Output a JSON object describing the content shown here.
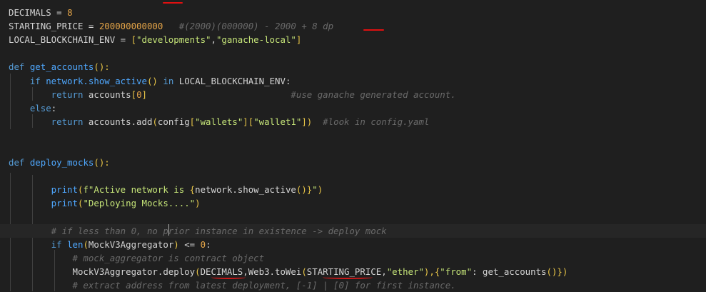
{
  "editor": {
    "lines": [
      {
        "segments": [
          {
            "t": "DECIMALS = ",
            "c": "var"
          },
          {
            "t": "8",
            "c": "num"
          }
        ]
      },
      {
        "segments": [
          {
            "t": "STARTING_PRICE = ",
            "c": "var"
          },
          {
            "t": "200000000000",
            "c": "num"
          },
          {
            "t": "   #(2000)(000000) - 2000 + 8 dp",
            "c": "cm"
          }
        ]
      },
      {
        "segments": [
          {
            "t": "LOCAL_BLOCKCHAIN_ENV = ",
            "c": "var"
          },
          {
            "t": "[",
            "c": "br"
          },
          {
            "t": "\"developments\"",
            "c": "str"
          },
          {
            "t": ",",
            "c": "op"
          },
          {
            "t": "\"ganache-local\"",
            "c": "str"
          },
          {
            "t": "]",
            "c": "br"
          }
        ]
      },
      {
        "segments": []
      },
      {
        "segments": [
          {
            "t": "def ",
            "c": "kw"
          },
          {
            "t": "get_accounts",
            "c": "fn"
          },
          {
            "t": "():",
            "c": "br"
          }
        ]
      },
      {
        "segments": [
          {
            "t": "    if ",
            "c": "kw"
          },
          {
            "t": "network.show_active",
            "c": "fn"
          },
          {
            "t": "() ",
            "c": "br"
          },
          {
            "t": "in ",
            "c": "kw"
          },
          {
            "t": "LOCAL_BLOCKCHAIN_ENV:",
            "c": "var"
          }
        ]
      },
      {
        "segments": [
          {
            "t": "        return ",
            "c": "kw"
          },
          {
            "t": "accounts",
            "c": "var"
          },
          {
            "t": "[",
            "c": "br"
          },
          {
            "t": "0",
            "c": "num"
          },
          {
            "t": "]",
            "c": "br"
          },
          {
            "t": "                           #use ganache generated account.",
            "c": "cm"
          }
        ]
      },
      {
        "segments": [
          {
            "t": "    else",
            "c": "kw"
          },
          {
            "t": ":",
            "c": "op"
          }
        ]
      },
      {
        "segments": [
          {
            "t": "        return ",
            "c": "kw"
          },
          {
            "t": "accounts.add",
            "c": "var"
          },
          {
            "t": "(",
            "c": "br"
          },
          {
            "t": "config",
            "c": "var"
          },
          {
            "t": "[",
            "c": "br"
          },
          {
            "t": "\"wallets\"",
            "c": "str"
          },
          {
            "t": "][",
            "c": "br"
          },
          {
            "t": "\"wallet1\"",
            "c": "str"
          },
          {
            "t": "])",
            "c": "br"
          },
          {
            "t": "  #look in config.yaml",
            "c": "cm"
          }
        ]
      },
      {
        "segments": []
      },
      {
        "segments": []
      },
      {
        "segments": [
          {
            "t": "def ",
            "c": "kw"
          },
          {
            "t": "deploy_mocks",
            "c": "fn"
          },
          {
            "t": "():",
            "c": "br"
          }
        ]
      },
      {
        "segments": []
      },
      {
        "segments": [
          {
            "t": "        print",
            "c": "fn"
          },
          {
            "t": "(",
            "c": "br"
          },
          {
            "t": "f\"Active network is ",
            "c": "str"
          },
          {
            "t": "{",
            "c": "br"
          },
          {
            "t": "network.show_active",
            "c": "var"
          },
          {
            "t": "()}",
            "c": "br"
          },
          {
            "t": "\"",
            "c": "str"
          },
          {
            "t": ")",
            "c": "br"
          }
        ]
      },
      {
        "segments": [
          {
            "t": "        print",
            "c": "fn"
          },
          {
            "t": "(",
            "c": "br"
          },
          {
            "t": "\"Deploying Mocks....\"",
            "c": "str"
          },
          {
            "t": ")",
            "c": "br"
          }
        ]
      },
      {
        "segments": []
      },
      {
        "segments": [
          {
            "t": "        # if less than 0, no prior instance in existence -> deploy mock",
            "c": "cm"
          }
        ]
      },
      {
        "segments": [
          {
            "t": "        if ",
            "c": "kw"
          },
          {
            "t": "len",
            "c": "fn"
          },
          {
            "t": "(",
            "c": "br"
          },
          {
            "t": "MockV3Aggregator",
            "c": "var"
          },
          {
            "t": ") ",
            "c": "br"
          },
          {
            "t": "<= ",
            "c": "op"
          },
          {
            "t": "0",
            "c": "num"
          },
          {
            "t": ":",
            "c": "op"
          }
        ]
      },
      {
        "segments": [
          {
            "t": "            # mock_aggregator is contract object",
            "c": "cm"
          }
        ]
      },
      {
        "segments": [
          {
            "t": "            MockV3Aggregator.deploy",
            "c": "var"
          },
          {
            "t": "(",
            "c": "br"
          },
          {
            "t": "DECIMALS",
            "c": "var"
          },
          {
            "t": ",Web3.toWei",
            "c": "var"
          },
          {
            "t": "(",
            "c": "br"
          },
          {
            "t": "STARTING_PRICE",
            "c": "var"
          },
          {
            "t": ",",
            "c": "op"
          },
          {
            "t": "\"ether\"",
            "c": "str"
          },
          {
            "t": "),{",
            "c": "br"
          },
          {
            "t": "\"from\"",
            "c": "str"
          },
          {
            "t": ": get_accounts",
            "c": "var"
          },
          {
            "t": "()})",
            "c": "br"
          }
        ]
      },
      {
        "segments": [
          {
            "t": "            # extract address from latest deployment, [-1] | [0] for first instance.",
            "c": "cm"
          }
        ]
      }
    ]
  },
  "colors": {
    "background": "#1f1f1f",
    "annotation": "#e01010"
  }
}
